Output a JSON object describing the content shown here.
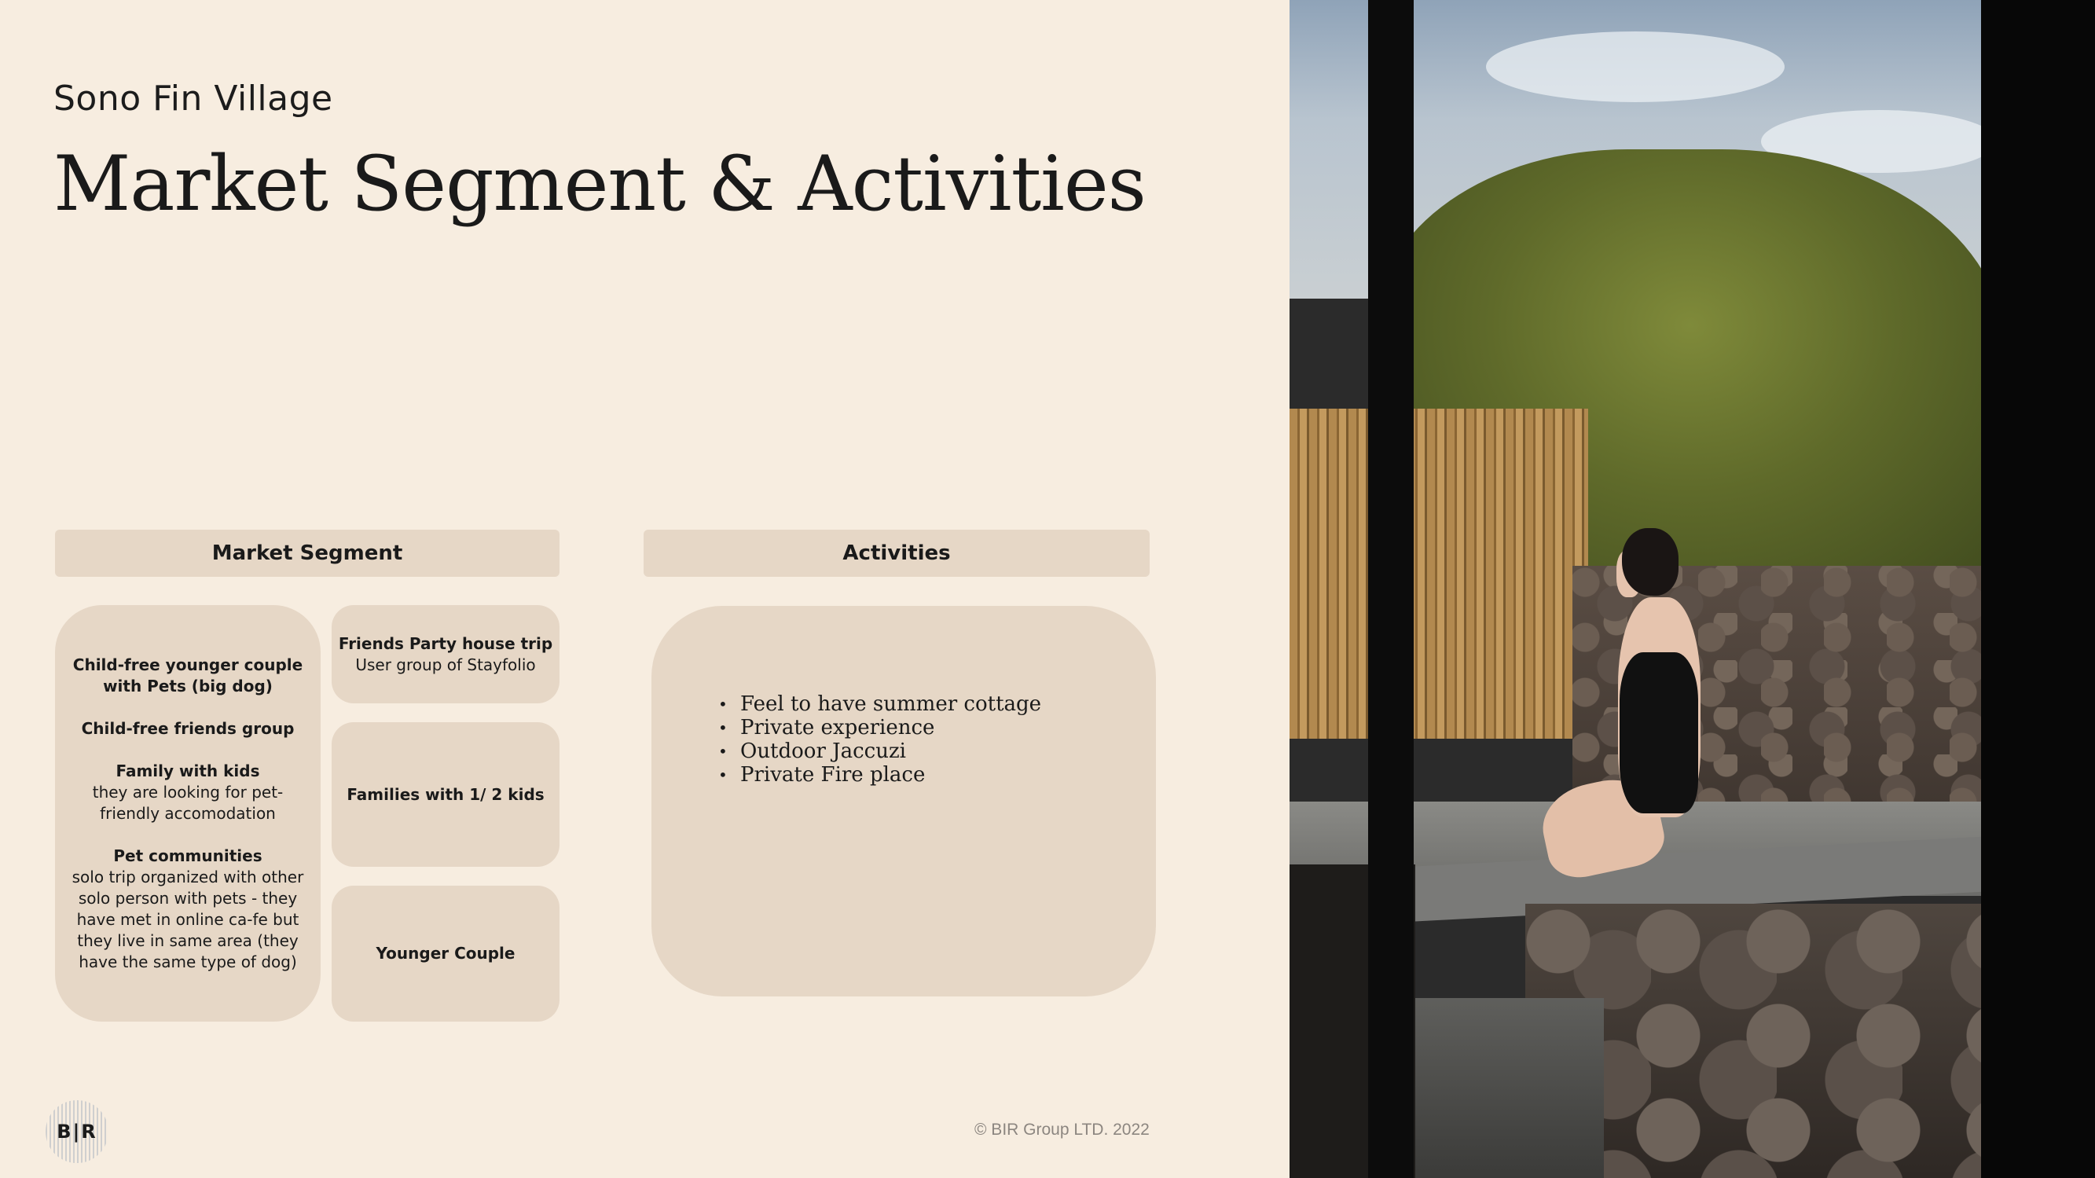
{
  "header": {
    "subtitle": "Sono Fin Village",
    "title": "Market Segment & Activities"
  },
  "market_segment": {
    "heading": "Market Segment",
    "main_card": {
      "items": [
        {
          "bold": "Child-free younger couple with Pets (big dog)",
          "desc": ""
        },
        {
          "bold": "Child-free friends group",
          "desc": ""
        },
        {
          "bold": "Family with kids",
          "desc": "they are looking for pet-friendly accomodation"
        },
        {
          "bold": "Pet communities",
          "desc": "solo trip organized with other solo person with pets - they have met in online ca-fe but they live in same area (they have the same type of dog)"
        }
      ]
    },
    "side_cards": [
      {
        "bold": "Friends Party house trip",
        "desc": "User group of Stayfolio"
      },
      {
        "bold": "Families with 1/ 2 kids",
        "desc": ""
      },
      {
        "bold": "Younger Couple",
        "desc": ""
      }
    ]
  },
  "activities": {
    "heading": "Activities",
    "items": [
      "Feel to have summer cottage",
      "Private experience",
      "Outdoor Jaccuzi",
      "Private Fire place"
    ]
  },
  "footer": {
    "logo_text": "B|R",
    "copyright": "© BIR Group LTD. 2022"
  }
}
